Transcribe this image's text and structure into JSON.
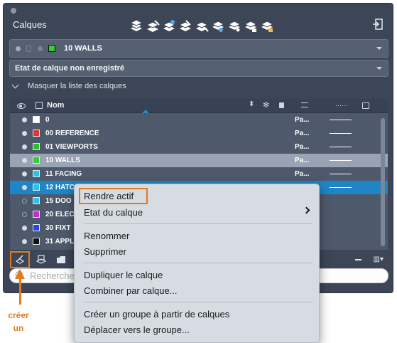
{
  "panel": {
    "title": "Calques",
    "current_layer": {
      "name": "10 WALLS",
      "color": "#2fd02f"
    },
    "state_label": "Etat de calque non enregistré",
    "toggle_label": "Masquer la liste des calques"
  },
  "toolbar_icons": [
    "layer-icon",
    "layer-icon",
    "layer-icon",
    "layer-icon",
    "layer-icon",
    "layer-icon",
    "layer-icon",
    "layer-icon",
    "layer-icon"
  ],
  "table": {
    "header": {
      "name": "Nom"
    },
    "rows": [
      {
        "name": "0",
        "color": "#ffffff",
        "visible": true,
        "plot": "Pa..."
      },
      {
        "name": "00 REFERENCE",
        "color": "#e23232",
        "visible": true,
        "plot": "Pa..."
      },
      {
        "name": "01 VIEWPORTS",
        "color": "#2fba2f",
        "visible": true,
        "plot": "Pa..."
      },
      {
        "name": "10 WALLS",
        "color": "#2fd02f",
        "visible": true,
        "plot": "Pa...",
        "selected": true
      },
      {
        "name": "11 FACING",
        "color": "#2bc4e8",
        "visible": true,
        "plot": "Pa..."
      },
      {
        "name": "12 HATC",
        "color": "#2bc4e8",
        "visible": true,
        "plot": "",
        "highlighted": true
      },
      {
        "name": "15 DOO",
        "color": "#2bc4e8",
        "visible": false,
        "plot": ""
      },
      {
        "name": "20 ELEC",
        "color": "#c22bd8",
        "visible": false,
        "plot": ""
      },
      {
        "name": "30 FIXT",
        "color": "#2b45e8",
        "visible": true,
        "plot": ""
      },
      {
        "name": "31 APPL",
        "color": "#111111",
        "visible": true,
        "plot": ""
      }
    ]
  },
  "search": {
    "placeholder": "Recherche"
  },
  "annotation": {
    "line1": "créer",
    "line2": "un"
  },
  "context_menu": {
    "items": [
      "Rendre actif",
      "Etat du calque",
      "Renommer",
      "Supprimer",
      "Dupliquer le calque",
      "Combiner par calque...",
      "Créer un groupe à partir de calques",
      "Déplacer vers le groupe..."
    ]
  },
  "colors": {
    "accent": "#e07c1a",
    "highlight": "#1e86c6",
    "panel": "#3c4657"
  }
}
